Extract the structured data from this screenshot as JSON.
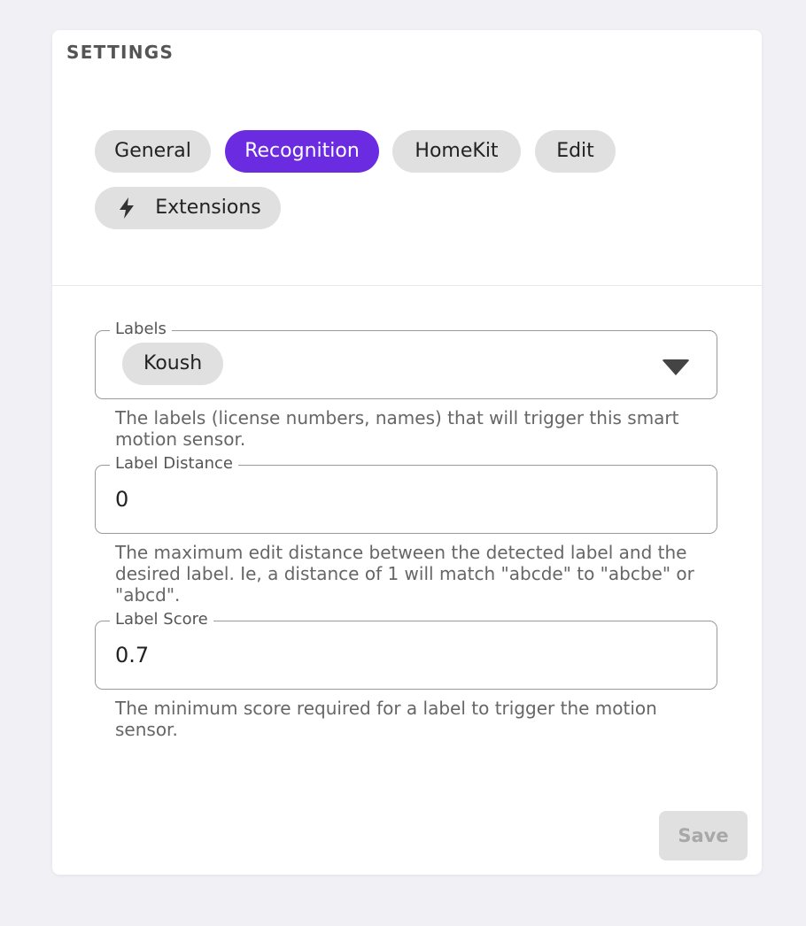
{
  "header": {
    "title": "SETTINGS"
  },
  "tabs": [
    {
      "label": "General",
      "active": false
    },
    {
      "label": "Recognition",
      "active": true
    },
    {
      "label": "HomeKit",
      "active": false
    },
    {
      "label": "Edit",
      "active": false
    },
    {
      "label": "Extensions",
      "active": false,
      "icon": "lightning-bolt-icon"
    }
  ],
  "fields": {
    "labels": {
      "legend": "Labels",
      "tags": [
        "Koush"
      ],
      "helper": "The labels (license numbers, names) that will trigger this smart motion sensor."
    },
    "label_distance": {
      "legend": "Label Distance",
      "value": "0",
      "helper": "The maximum edit distance between the detected label and the desired label. Ie, a distance of 1 will match \"abcde\" to \"abcbe\" or \"abcd\"."
    },
    "label_score": {
      "legend": "Label Score",
      "value": "0.7",
      "helper": "The minimum score required for a label to trigger the motion sensor."
    }
  },
  "actions": {
    "save_label": "Save",
    "save_disabled": true
  },
  "colors": {
    "accent": "#6b2be0",
    "chip": "#e0e0e0",
    "background": "#f0f0f5"
  }
}
